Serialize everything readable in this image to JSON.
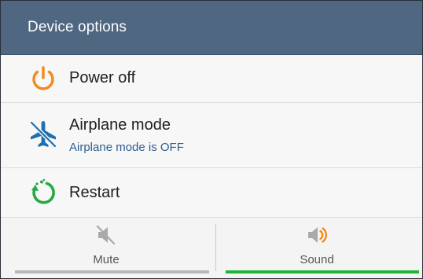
{
  "dialog": {
    "title": "Device options",
    "header_color": "#4f6780"
  },
  "options": {
    "power_off": {
      "label": "Power off",
      "icon": "power-icon",
      "icon_color": "#f08a1c"
    },
    "airplane_mode": {
      "label": "Airplane mode",
      "status": "Airplane mode is OFF",
      "icon": "airplane-off-icon",
      "icon_color": "#1f6fb0"
    },
    "restart": {
      "label": "Restart",
      "icon": "restart-icon",
      "icon_color": "#26a844"
    }
  },
  "sound_mode": {
    "mute": {
      "label": "Mute",
      "icon": "speaker-mute-icon",
      "selected": false
    },
    "sound": {
      "label": "Sound",
      "icon": "speaker-sound-icon",
      "selected": true,
      "accent_color": "#1fb53a"
    }
  }
}
